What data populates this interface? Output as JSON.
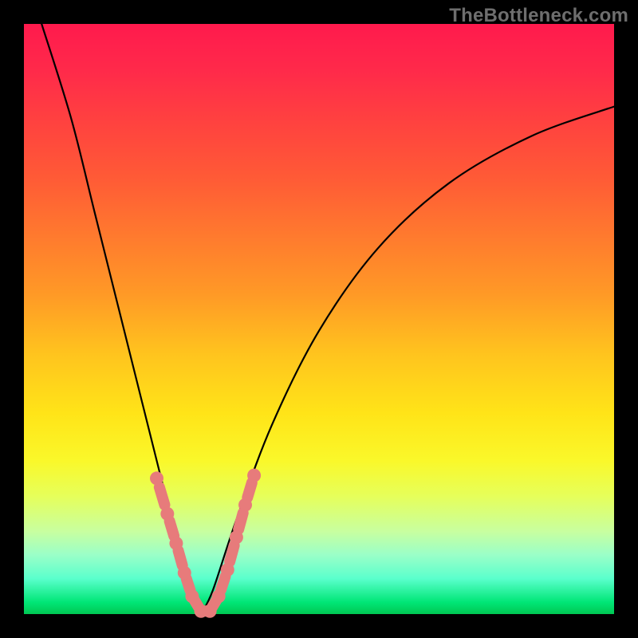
{
  "watermark": "TheBottleneck.com",
  "chart_data": {
    "type": "line",
    "title": "",
    "xlabel": "",
    "ylabel": "",
    "xlim": [
      0,
      100
    ],
    "ylim": [
      0,
      100
    ],
    "grid": false,
    "legend": false,
    "curve_left": {
      "comment": "Left descending branch of V curve; points as [x_percent, y_percent] where y is height from bottom",
      "points": [
        [
          3,
          100
        ],
        [
          8,
          84
        ],
        [
          12,
          68
        ],
        [
          16,
          52
        ],
        [
          20,
          36
        ],
        [
          24,
          20
        ],
        [
          27,
          8
        ],
        [
          29,
          2
        ],
        [
          30,
          0
        ]
      ]
    },
    "curve_right": {
      "comment": "Right ascending branch rising with diminishing slope",
      "points": [
        [
          30,
          0
        ],
        [
          32,
          4
        ],
        [
          36,
          16
        ],
        [
          42,
          32
        ],
        [
          50,
          48
        ],
        [
          60,
          62
        ],
        [
          72,
          73
        ],
        [
          86,
          81
        ],
        [
          100,
          86
        ]
      ]
    },
    "markers": {
      "comment": "Salmon bead-like markers clustered near the valley along both branches",
      "points": [
        [
          22.5,
          23
        ],
        [
          24.3,
          17
        ],
        [
          25.8,
          12
        ],
        [
          27.2,
          7
        ],
        [
          28.5,
          3
        ],
        [
          30.0,
          0.5
        ],
        [
          31.5,
          0.5
        ],
        [
          33.0,
          3
        ],
        [
          34.5,
          7.5
        ],
        [
          36.0,
          13
        ],
        [
          37.5,
          18.5
        ],
        [
          39.0,
          23.5
        ]
      ],
      "color": "#e77b7b"
    },
    "gradient_bands": {
      "comment": "Background vertical gradient from red (high mismatch) at top to green (optimal) at bottom",
      "stops": [
        {
          "pos": 0,
          "color": "#ff1a4d"
        },
        {
          "pos": 50,
          "color": "#ffc41e"
        },
        {
          "pos": 75,
          "color": "#faf82a"
        },
        {
          "pos": 100,
          "color": "#00c853"
        }
      ]
    }
  }
}
